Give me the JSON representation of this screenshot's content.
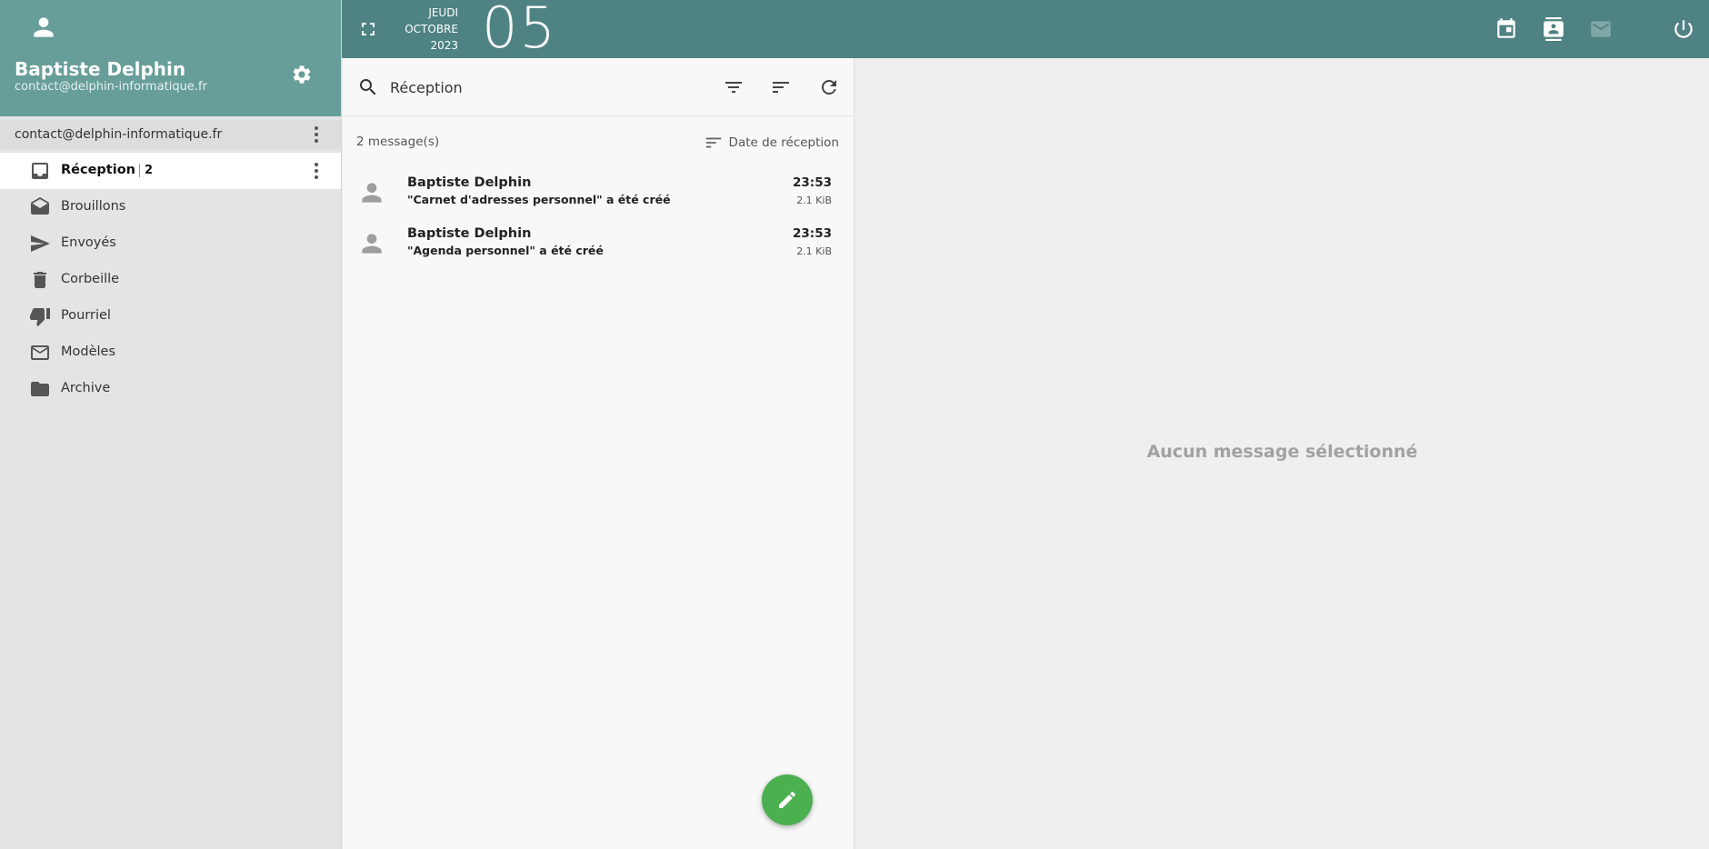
{
  "user": {
    "name": "Baptiste Delphin",
    "email": "contact@delphin-informatique.fr"
  },
  "account": {
    "label": "contact@delphin-informatique.fr"
  },
  "folders": [
    {
      "name": "Réception",
      "count": "2",
      "icon": "inbox-icon",
      "active": true
    },
    {
      "name": "Brouillons",
      "icon": "drafts-icon"
    },
    {
      "name": "Envoyés",
      "icon": "send-icon"
    },
    {
      "name": "Corbeille",
      "icon": "trash-icon"
    },
    {
      "name": "Pourriel",
      "icon": "thumb-down-icon"
    },
    {
      "name": "Modèles",
      "icon": "mail-outline-icon"
    },
    {
      "name": "Archive",
      "icon": "folder-icon"
    }
  ],
  "date": {
    "weekday": "JEUDI",
    "month": "OCTOBRE",
    "year": "2023",
    "day": "05"
  },
  "topbar": {
    "icons": [
      "calendar-icon",
      "contacts-icon",
      "mail-icon",
      "power-icon"
    ]
  },
  "search": {
    "value": "Réception"
  },
  "list": {
    "count": "2 message(s)",
    "sort_label": "Date de réception",
    "messages": [
      {
        "sender": "Baptiste Delphin",
        "subject": "\"Carnet d'adresses personnel\" a été créé",
        "time": "23:53",
        "size": "2.1 KiB"
      },
      {
        "sender": "Baptiste Delphin",
        "subject": "\"Agenda personnel\" a été créé",
        "time": "23:53",
        "size": "2.1 KiB"
      }
    ]
  },
  "reading": {
    "empty_text": "Aucun message sélectionné"
  },
  "colors": {
    "header_teal": "#679e99",
    "topbar_teal": "#4f8283",
    "compose_green": "#4caf50"
  }
}
